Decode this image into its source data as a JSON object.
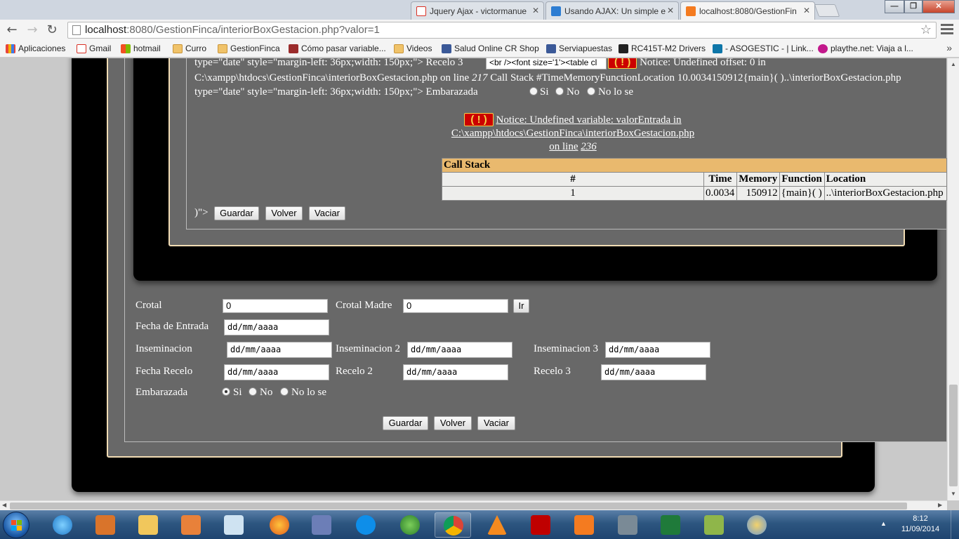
{
  "browser": {
    "tabs": [
      {
        "title": "Jquery Ajax - victormanue",
        "favicon": "gmail-icon",
        "color": "#d93025"
      },
      {
        "title": "Usando AJAX: Un simple e",
        "favicon": "vscode-icon",
        "color": "#2d7dd2"
      },
      {
        "title": "localhost:8080/GestionFin",
        "favicon": "xampp-icon",
        "color": "#f47b20"
      }
    ],
    "address_host": "localhost",
    "address_path": ":8080/GestionFinca/interiorBoxGestacion.php?valor=1",
    "bookmarks": [
      {
        "label": "Aplicaciones",
        "icon": "apps-icon"
      },
      {
        "label": "Gmail",
        "icon": "gmail-icon"
      },
      {
        "label": "hotmail",
        "icon": "windows-icon"
      },
      {
        "label": "Curro",
        "icon": "folder-icon"
      },
      {
        "label": "GestionFinca",
        "icon": "folder-icon"
      },
      {
        "label": "Cómo pasar variable...",
        "icon": "book-icon"
      },
      {
        "label": "Videos",
        "icon": "folder-icon"
      },
      {
        "label": "Salud Online CR Shop",
        "icon": "facebook-icon"
      },
      {
        "label": "Serviapuestas",
        "icon": "facebook-icon"
      },
      {
        "label": "RC415T-M2 Drivers",
        "icon": "asus-icon"
      },
      {
        "label": "- ASOGESTIC - | Link...",
        "icon": "linkedin-icon"
      },
      {
        "label": "playthe.net: Viaja a l...",
        "icon": "playthe-icon"
      }
    ],
    "bookmarks_more": "»"
  },
  "inner": {
    "line1_prefix": "type=\"date\" style=\"margin-left: 36px;width: 150px;\"> Recelo 3",
    "line1_input_value": "<br /><font size='1'><table cl",
    "line1_notice": "Notice: Undefined offset: 0 in",
    "line2": "C:\\xampp\\htdocs\\GestionFinca\\interiorBoxGestacion.php on line",
    "line2_lineno": "217",
    "line2_rest": "Call Stack #TimeMemoryFunctionLocation 10.0034150912{main}( )..\\interiorBoxGestacion.php",
    "line3_prefix": "type=\"date\" style=\"margin-left: 36px;width: 150px;\"> Embarazada",
    "line3_radios": [
      "Si",
      "No",
      "No lo se"
    ],
    "notice2_line1": "Notice: Undefined variable: valorEntrada in",
    "notice2_line2": "C:\\xampp\\htdocs\\GestionFinca\\interiorBoxGestacion.php",
    "notice2_line3_prefix": "on line",
    "notice2_lineno": "236",
    "bang": "( ! )",
    "callstack_title": "Call Stack",
    "callstack_headers": [
      "#",
      "Time",
      "Memory",
      "Function",
      "Location"
    ],
    "callstack_row": [
      "1",
      "0.0034",
      "150912",
      "{main}( )",
      "..\\interiorBoxGestacion.php"
    ],
    "tail_text": ")\">",
    "btn_guardar": "Guardar",
    "btn_volver": "Volver",
    "btn_vaciar": "Vaciar"
  },
  "form": {
    "crotal_label": "Crotal",
    "crotal_value": "0",
    "crotal_madre_label": "Crotal Madre",
    "crotal_madre_value": "0",
    "ir_button": "Ir",
    "fecha_entrada_label": "Fecha de Entrada",
    "date_placeholder": "dd/mm/aaaa",
    "inseminacion_label": "Inseminacion",
    "inseminacion2_label": "Inseminacion 2",
    "inseminacion3_label": "Inseminacion 3",
    "fecha_recelo_label": "Fecha Recelo",
    "recelo2_label": "Recelo 2",
    "recelo3_label": "Recelo 3",
    "embarazada_label": "Embarazada",
    "radios": [
      "Si",
      "No",
      "No lo se"
    ],
    "selected_radio": "Si",
    "btn_guardar": "Guardar",
    "btn_volver": "Volver",
    "btn_vaciar": "Vaciar"
  },
  "taskbar": {
    "apps": [
      "internet-explorer-icon",
      "installer-icon",
      "file-explorer-icon",
      "media-player-icon",
      "notepad-icon",
      "firefox-icon",
      "php-icon",
      "teamviewer-icon",
      "network-icon",
      "chrome-icon",
      "vlc-icon",
      "filezilla-icon",
      "xampp-icon",
      "monitor-icon",
      "excel-icon",
      "notepadpp-icon",
      "paint-icon"
    ],
    "clock_time": "8:12",
    "clock_date": "11/09/2014"
  },
  "colors": {
    "panel_gray": "#686868",
    "frame_black": "#000000",
    "cream_border": "#f1dcb4",
    "callstack_header": "#e9b96e",
    "error_red": "#cc0000"
  }
}
